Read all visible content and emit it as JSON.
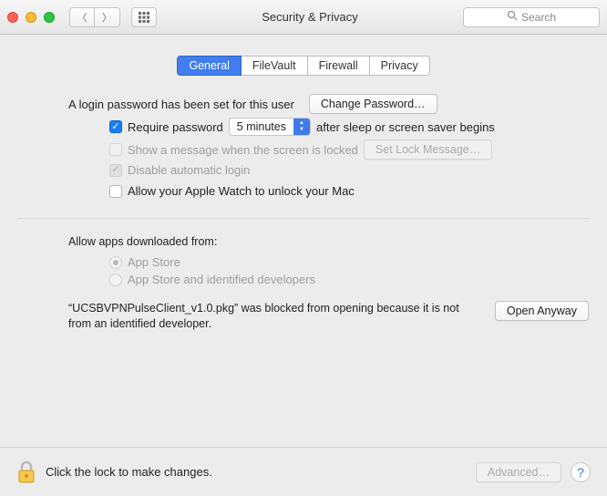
{
  "window": {
    "title": "Security & Privacy",
    "search_placeholder": "Search"
  },
  "tabs": [
    "General",
    "FileVault",
    "Firewall",
    "Privacy"
  ],
  "login": {
    "password_set_text": "A login password has been set for this user",
    "change_password_btn": "Change Password…",
    "require_password_label": "Require password",
    "require_password_delay": "5 minutes",
    "after_sleep_text": "after sleep or screen saver begins",
    "show_message_label": "Show a message when the screen is locked",
    "set_lock_message_btn": "Set Lock Message…",
    "disable_auto_login_label": "Disable automatic login",
    "apple_watch_label": "Allow your Apple Watch to unlock your Mac"
  },
  "gatekeeper": {
    "header": "Allow apps downloaded from:",
    "option_app_store": "App Store",
    "option_identified": "App Store and identified developers",
    "blocked_message": "“UCSBVPNPulseClient_v1.0.pkg” was blocked from opening because it is not from an identified developer.",
    "open_anyway_btn": "Open Anyway"
  },
  "footer": {
    "lock_text": "Click the lock to make changes.",
    "advanced_btn": "Advanced…"
  }
}
